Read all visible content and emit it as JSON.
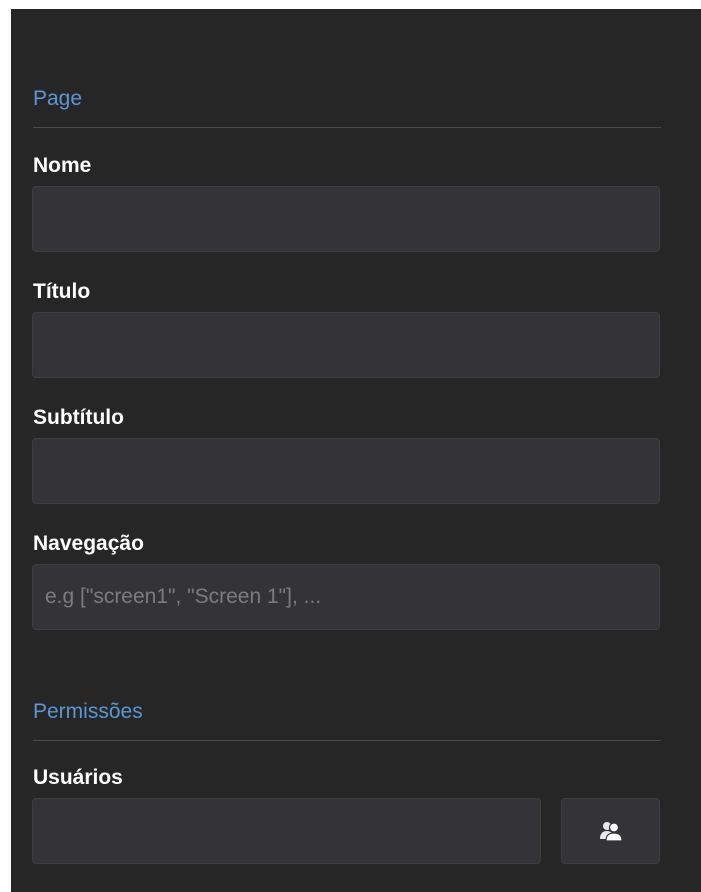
{
  "page_section": {
    "title": "Page",
    "fields": {
      "nome": {
        "label": "Nome",
        "value": "",
        "placeholder": ""
      },
      "titulo": {
        "label": "Título",
        "value": "",
        "placeholder": ""
      },
      "subtitulo": {
        "label": "Subtítulo",
        "value": "",
        "placeholder": ""
      },
      "navegacao": {
        "label": "Navegação",
        "value": "",
        "placeholder": "e.g [\"screen1\", \"Screen 1\"], ..."
      }
    }
  },
  "permissions_section": {
    "title": "Permissões",
    "users": {
      "label": "Usuários",
      "value": "",
      "placeholder": "",
      "button_icon": "users-icon"
    }
  },
  "colors": {
    "panel_background": "#262626",
    "section_title": "#5b97d1",
    "input_background": "#333338",
    "label_text": "#ffffff"
  }
}
